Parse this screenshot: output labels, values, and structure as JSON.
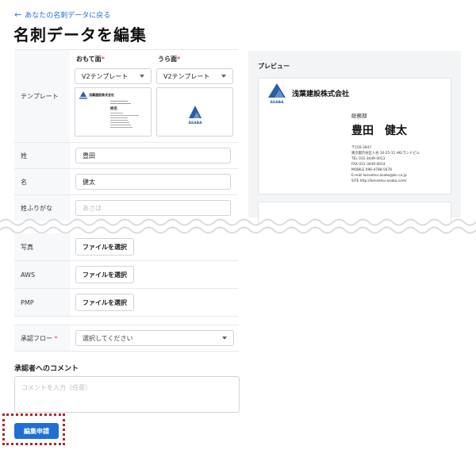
{
  "nav": {
    "back_label": "あなたの名刺データに戻る"
  },
  "page": {
    "title": "名刺データを編集"
  },
  "template": {
    "label": "テンプレート",
    "front": {
      "heading": "おもて面",
      "selected": "V2テンプレート"
    },
    "back": {
      "heading": "うら面",
      "selected": "V2テンプレート"
    },
    "thumb_company": "浅葉建設株式会社",
    "thumb_name": "姓名",
    "back_logo_text": "ASABA"
  },
  "fields": {
    "last_name": {
      "label": "姓",
      "value": "豊田"
    },
    "first_name": {
      "label": "名",
      "value": "健太"
    },
    "kana": {
      "label": "姓ふりがな",
      "placeholder": "あさば"
    },
    "photo": {
      "label": "写真",
      "button": "ファイルを選択"
    },
    "aws": {
      "label": "AWS",
      "button": "ファイルを選択"
    },
    "pmp": {
      "label": "PMP",
      "button": "ファイルを選択"
    },
    "approval": {
      "label": "承認フロー",
      "placeholder": "選択してください"
    }
  },
  "comment": {
    "label": "承認者へのコメント",
    "placeholder": "コメントを入力（任意）"
  },
  "submit_label": "編集申請",
  "preview": {
    "heading": "プレビュー",
    "company": "浅葉建設株式会社",
    "logo_text": "ASABA",
    "department": "総務部",
    "name": "豊田　健太",
    "postal": "〒150-3947",
    "address": "東京都渋谷区入谷 10-25-11 HIGランドビル",
    "tel": "TEL 031-3449-0013",
    "fax": "FAX 031-3449-0014",
    "mobile": "MOBILE 096-4788-5678",
    "email": "E-mail kensetsu-asaba@kn.co.jp",
    "site": "SITE http://kensetsu-asaba.com/"
  },
  "colors": {
    "accent": "#1f6fd6",
    "logo": "#2a5ea8",
    "required": "#d9534f",
    "highlight": "#b4232a"
  }
}
